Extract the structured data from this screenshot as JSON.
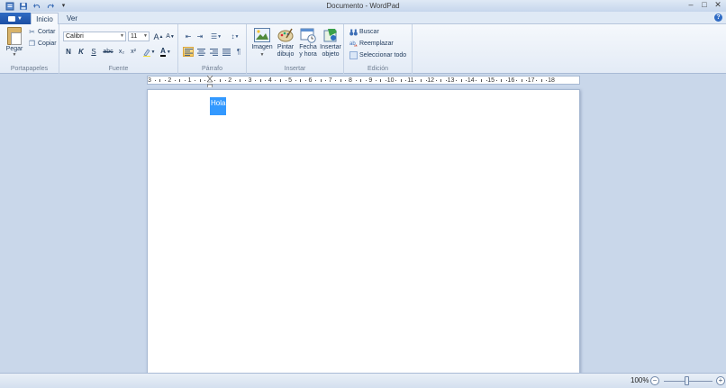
{
  "window": {
    "title": "Documento - WordPad",
    "controls": {
      "minimize": "–",
      "maximize": "□",
      "close": "✕"
    }
  },
  "quick_access": {
    "save_icon": "save-icon",
    "undo_icon": "undo-icon",
    "redo_icon": "redo-icon",
    "customize_icon": "chevron-down-icon"
  },
  "tabs": [
    {
      "label": "Inicio"
    },
    {
      "label": "Ver"
    }
  ],
  "ribbon": {
    "portapapeles": {
      "label": "Portapapeles",
      "pegar": "Pegar",
      "cortar": "Cortar",
      "copiar": "Copiar"
    },
    "fuente": {
      "label": "Fuente",
      "font_name": "Calibri",
      "font_size": "11",
      "bold": "N",
      "italic": "K",
      "underline": "S",
      "strike": "abc",
      "subscript": "x₂",
      "superscript": "x²",
      "grow": "A",
      "shrink": "A",
      "highlight_icon": "highlighter-icon",
      "color_label": "A"
    },
    "parrafo": {
      "label": "Párrafo"
    },
    "insertar": {
      "label": "Insertar",
      "imagen": "Imagen",
      "pintar_1": "Pintar",
      "pintar_2": "dibujo",
      "fecha_1": "Fecha",
      "fecha_2": "y hora",
      "insertar_1": "Insertar",
      "insertar_2": "objeto"
    },
    "edicion": {
      "label": "Edición",
      "buscar": "Buscar",
      "reemplazar": "Reemplazar",
      "seleccionar": "Seleccionar todo"
    }
  },
  "ruler": {
    "numbers": [
      "3",
      "2",
      "1",
      "1",
      "2",
      "3",
      "4",
      "5",
      "6",
      "7",
      "8",
      "9",
      "10",
      "11",
      "12",
      "13",
      "14",
      "15",
      "16",
      "17",
      "18"
    ]
  },
  "document": {
    "text": "Hola"
  },
  "status": {
    "zoom": "100%"
  },
  "colors": {
    "selection": "#3399ff",
    "accent": "#2f6bc4",
    "background": "#c9d7ea"
  }
}
